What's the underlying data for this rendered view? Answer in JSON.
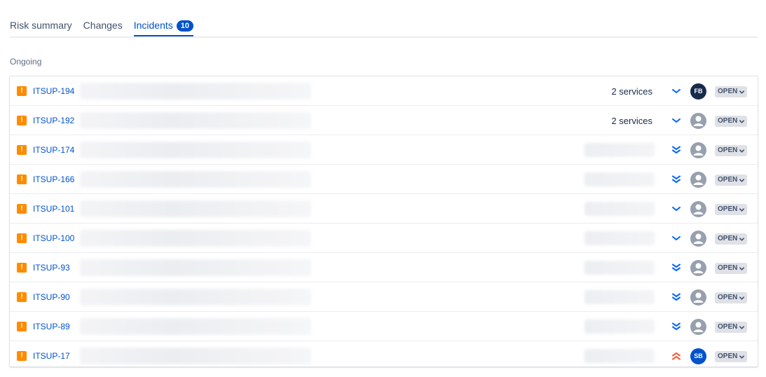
{
  "tabs": [
    {
      "label": "Risk summary",
      "active": false
    },
    {
      "label": "Changes",
      "active": false
    },
    {
      "label": "Incidents",
      "active": true,
      "badge": "10"
    }
  ],
  "section_label": "Ongoing",
  "incidents": [
    {
      "key": "ITSUP-194",
      "services": "2 services",
      "priority": "low",
      "assignee": "FB",
      "assignee_style": "dark",
      "status": "OPEN"
    },
    {
      "key": "ITSUP-192",
      "services": "2 services",
      "priority": "low",
      "assignee": "",
      "assignee_style": "default",
      "status": "OPEN"
    },
    {
      "key": "ITSUP-174",
      "services": "",
      "priority": "lowest",
      "assignee": "",
      "assignee_style": "default",
      "status": "OPEN"
    },
    {
      "key": "ITSUP-166",
      "services": "",
      "priority": "lowest",
      "assignee": "",
      "assignee_style": "default",
      "status": "OPEN"
    },
    {
      "key": "ITSUP-101",
      "services": "",
      "priority": "low",
      "assignee": "",
      "assignee_style": "default",
      "status": "OPEN"
    },
    {
      "key": "ITSUP-100",
      "services": "",
      "priority": "low",
      "assignee": "",
      "assignee_style": "default",
      "status": "OPEN"
    },
    {
      "key": "ITSUP-93",
      "services": "",
      "priority": "lowest",
      "assignee": "",
      "assignee_style": "default",
      "status": "OPEN"
    },
    {
      "key": "ITSUP-90",
      "services": "",
      "priority": "lowest",
      "assignee": "",
      "assignee_style": "default",
      "status": "OPEN"
    },
    {
      "key": "ITSUP-89",
      "services": "",
      "priority": "lowest",
      "assignee": "",
      "assignee_style": "default",
      "status": "OPEN"
    },
    {
      "key": "ITSUP-17",
      "services": "",
      "priority": "highest",
      "assignee": "SB",
      "assignee_style": "blue",
      "status": "OPEN"
    }
  ],
  "colors": {
    "accent": "#0052CC",
    "incident_icon": "#FF8B00",
    "priority_low": "#0065FF",
    "priority_high": "#FF5630"
  },
  "icons": {
    "incident": "incident-icon",
    "priority_low": "chevron-down-icon",
    "priority_lowest": "double-chevron-down-icon",
    "priority_highest": "double-chevron-up-icon",
    "status_dropdown": "chevron-down-icon"
  }
}
